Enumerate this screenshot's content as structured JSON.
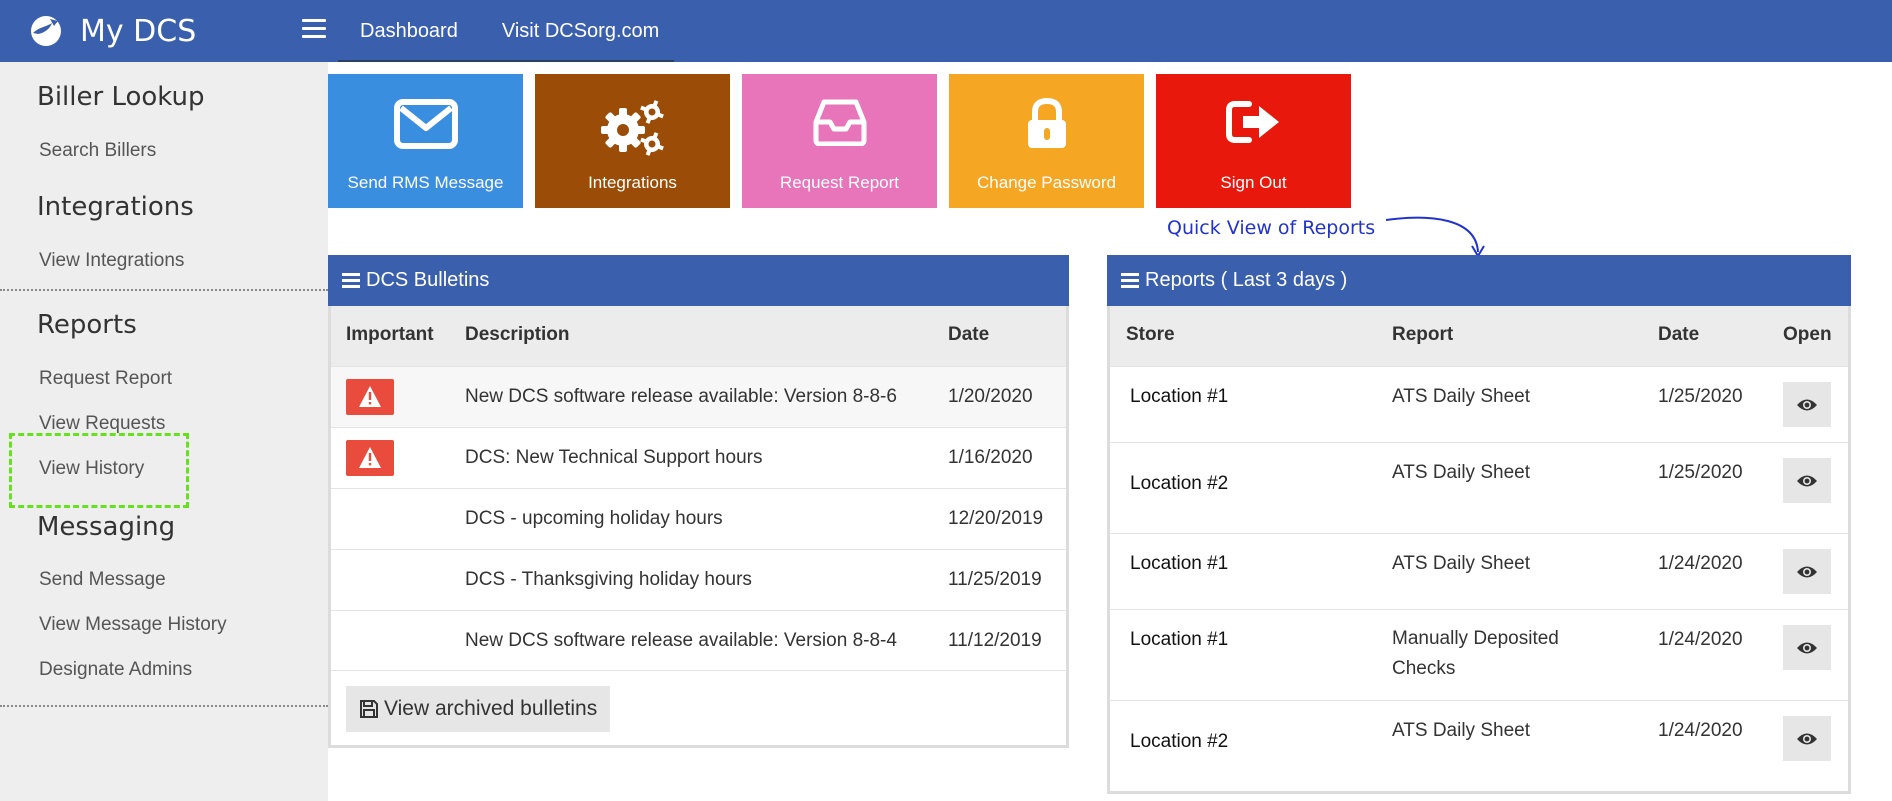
{
  "header": {
    "title": "My DCS",
    "nav": [
      {
        "label": "Dashboard"
      },
      {
        "label": "Visit DCSorg.com"
      }
    ]
  },
  "sidebar": {
    "sections": [
      {
        "heading": "Biller Lookup",
        "links": [
          "Search Billers"
        ]
      },
      {
        "heading": "Integrations",
        "links": [
          "View Integrations"
        ]
      },
      {
        "heading": "Reports",
        "links": [
          "Request Report",
          "View Requests",
          "View History"
        ]
      },
      {
        "heading": "Messaging",
        "links": [
          "Send Message",
          "View Message History",
          "Designate Admins"
        ]
      }
    ],
    "highlighted_link": "View History",
    "highlight_color": "#66e01f"
  },
  "tiles": [
    {
      "label": "Send RMS Message",
      "icon": "envelope-icon",
      "color": "#3a8ee0"
    },
    {
      "label": "Integrations",
      "icon": "gears-icon",
      "color": "#9b4d07"
    },
    {
      "label": "Request Report",
      "icon": "inbox-icon",
      "color": "#e875b9"
    },
    {
      "label": "Change Password",
      "icon": "lock-icon",
      "color": "#f5a623"
    },
    {
      "label": "Sign Out",
      "icon": "sign-out-icon",
      "color": "#e8190c"
    }
  ],
  "annotation": {
    "text": "Quick View of Reports",
    "color": "#2233cc"
  },
  "bulletins": {
    "title": "DCS Bulletins",
    "columns": [
      "Important",
      "Description",
      "Date"
    ],
    "rows": [
      {
        "important": true,
        "description": "New DCS software release available: Version 8-8-6",
        "date": "1/20/2020"
      },
      {
        "important": true,
        "description": "DCS: New Technical Support hours",
        "date": "1/16/2020"
      },
      {
        "important": false,
        "description": "DCS - upcoming holiday hours",
        "date": "12/20/2019"
      },
      {
        "important": false,
        "description": "DCS - Thanksgiving holiday hours",
        "date": "11/25/2019"
      },
      {
        "important": false,
        "description": "New DCS software release available: Version 8-8-4",
        "date": "11/12/2019"
      }
    ],
    "archive_button": "View archived bulletins"
  },
  "reports": {
    "title": "Reports ( Last 3 days )",
    "columns": [
      "Store",
      "Report",
      "Date",
      "Open"
    ],
    "rows": [
      {
        "store": "Location #1",
        "report": "ATS Daily Sheet",
        "date": "1/25/2020"
      },
      {
        "store": "Location #2",
        "report": "ATS Daily Sheet",
        "date": "1/25/2020"
      },
      {
        "store": "Location #1",
        "report": "ATS Daily Sheet",
        "date": "1/24/2020"
      },
      {
        "store": "Location #1",
        "report": "Manually Deposited Checks",
        "date": "1/24/2020"
      },
      {
        "store": "Location #2",
        "report": "ATS Daily Sheet",
        "date": "1/24/2020"
      }
    ]
  },
  "colors": {
    "brand": "#3a60ad",
    "alert": "#e94b3c"
  }
}
